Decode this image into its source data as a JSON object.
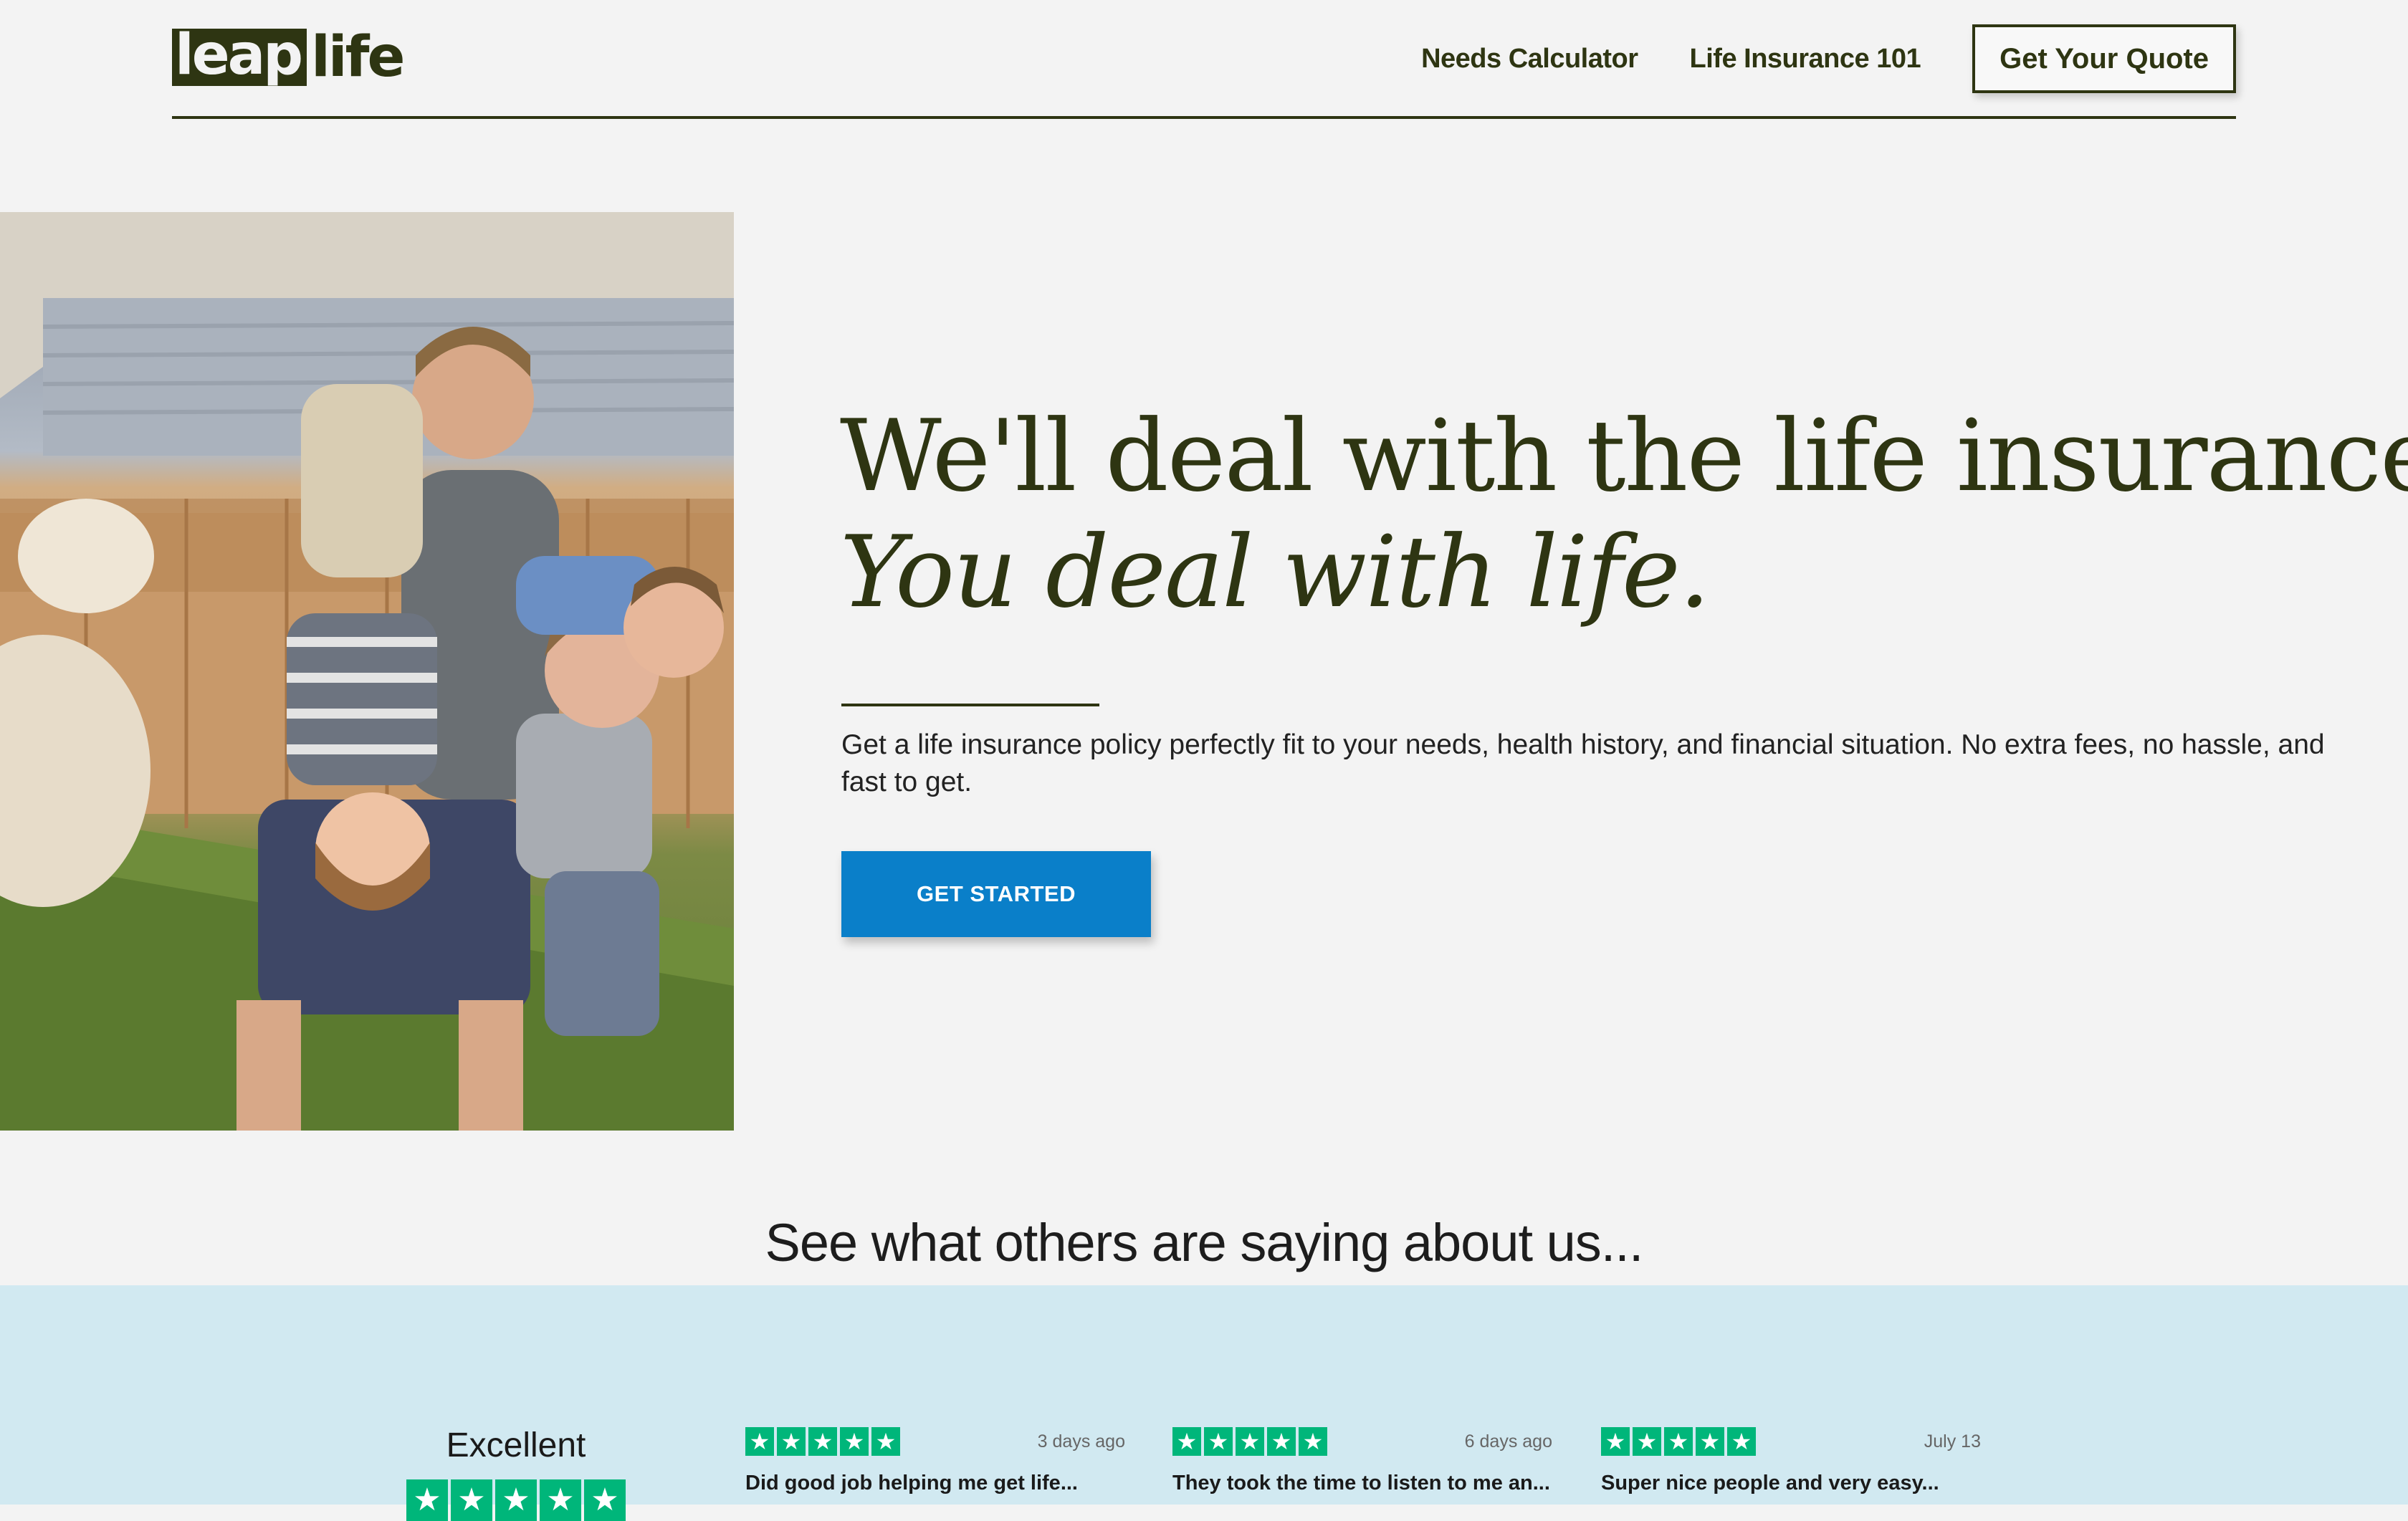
{
  "header": {
    "logo_part1": "leap",
    "logo_part2": "life",
    "nav": [
      {
        "label": "Needs Calculator"
      },
      {
        "label": "Life Insurance 101"
      }
    ],
    "quote_button": "Get Your Quote"
  },
  "hero": {
    "headline_line1": "We'll deal with the life insurance.",
    "headline_line2": "You deal with life.",
    "subcopy": "Get a life insurance policy perfectly fit to your needs, health history, and financial situation. No extra fees, no hassle, and fast to get.",
    "cta": "GET STARTED"
  },
  "reviews": {
    "title": "See what others are saying about us...",
    "summary": {
      "rating_word": "Excellent",
      "stars": 5
    },
    "items": [
      {
        "stars": 5,
        "date": "3 days ago",
        "title": "Did good job helping me get life..."
      },
      {
        "stars": 5,
        "date": "6 days ago",
        "title": "They took the time to listen to me an..."
      },
      {
        "stars": 5,
        "date": "July 13",
        "title": "Super nice people and very easy..."
      }
    ]
  },
  "colors": {
    "brand_dark": "#2e3512",
    "background": "#f3f3f3",
    "cta_blue": "#0a7fc9",
    "reviews_band": "#d1e9f1",
    "trustpilot_green": "#00b67a"
  },
  "icons": {
    "star": "star-icon"
  }
}
